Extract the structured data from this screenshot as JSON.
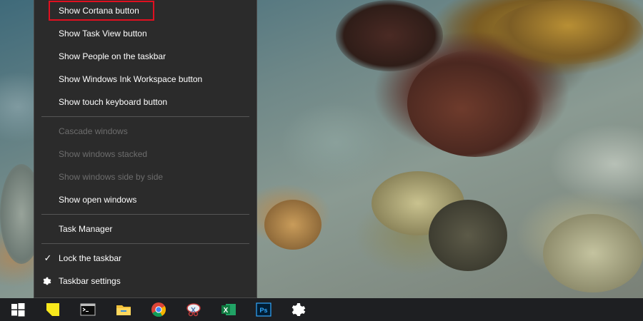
{
  "context_menu": {
    "items": [
      {
        "label": "Show Cortana button",
        "enabled": true,
        "highlighted": true
      },
      {
        "label": "Show Task View button",
        "enabled": true
      },
      {
        "label": "Show People on the taskbar",
        "enabled": true
      },
      {
        "label": "Show Windows Ink Workspace button",
        "enabled": true
      },
      {
        "label": "Show touch keyboard button",
        "enabled": true
      },
      {
        "label": "Cascade windows",
        "enabled": false
      },
      {
        "label": "Show windows stacked",
        "enabled": false
      },
      {
        "label": "Show windows side by side",
        "enabled": false
      },
      {
        "label": "Show open windows",
        "enabled": true
      },
      {
        "label": "Task Manager",
        "enabled": true
      },
      {
        "label": "Lock the taskbar",
        "enabled": true,
        "checked": true
      },
      {
        "label": "Taskbar settings",
        "enabled": true,
        "icon": "gear-icon"
      }
    ],
    "check_glyph": "✓"
  },
  "taskbar": {
    "icons": [
      "windows-start-icon",
      "sticky-notes-icon",
      "command-prompt-icon",
      "file-explorer-icon",
      "chrome-icon",
      "snipping-tool-icon",
      "excel-icon",
      "photoshop-icon",
      "settings-gear-icon"
    ],
    "excel_letter": "X",
    "photoshop_letters": "Ps"
  },
  "colors": {
    "menu_bg": "#2b2b2b",
    "menu_text": "#ffffff",
    "menu_disabled_text": "#6d6d6d",
    "highlight_border": "#e01020",
    "taskbar_bg": "#1e1f22"
  }
}
